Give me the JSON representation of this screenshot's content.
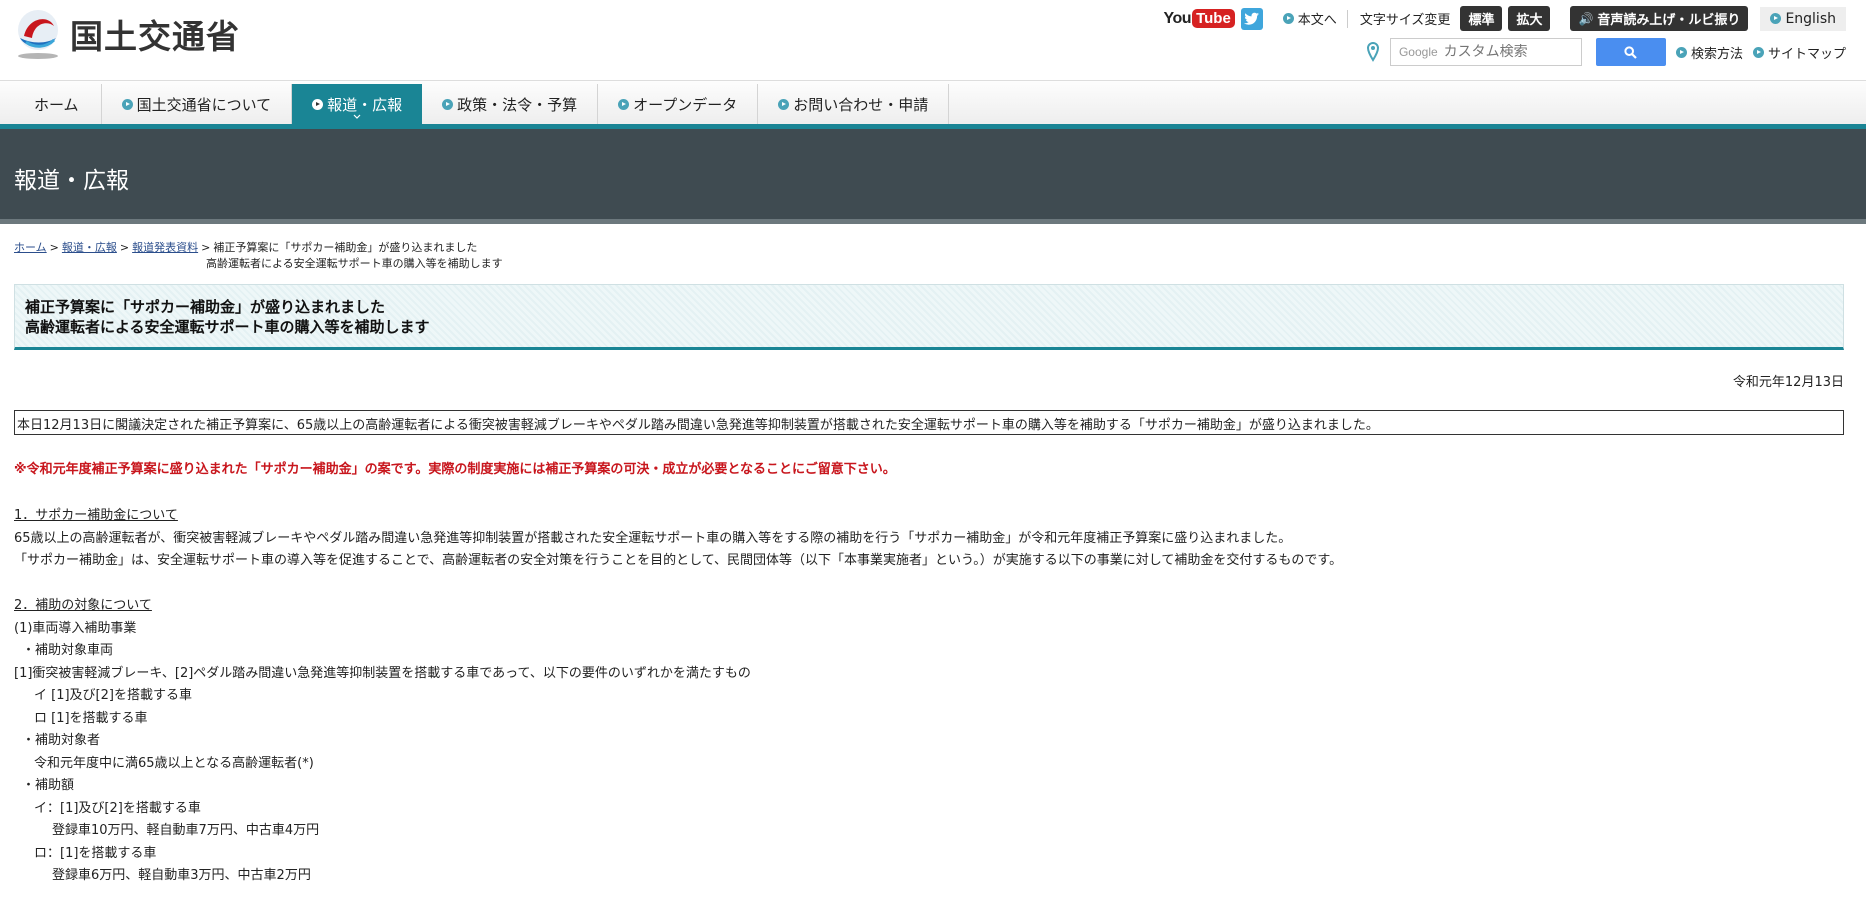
{
  "header": {
    "logo_text": "国土交通省",
    "youtube_you": "You",
    "youtube_tube": "Tube",
    "link_main": "本文へ",
    "text_size_label": "文字サイズ変更",
    "size_standard": "標準",
    "size_large": "拡大",
    "voice_label": "音声読み上げ・ルビ振り",
    "english_label": "English",
    "search_google": "Google",
    "search_placeholder": "カスタム検索",
    "link_search_method": "検索方法",
    "link_sitemap": "サイトマップ"
  },
  "nav": {
    "items": [
      {
        "label": "ホーム"
      },
      {
        "label": "国土交通省について"
      },
      {
        "label": "報道・広報"
      },
      {
        "label": "政策・法令・予算"
      },
      {
        "label": "オープンデータ"
      },
      {
        "label": "お問い合わせ・申請"
      }
    ]
  },
  "page": {
    "title": "報道・広報"
  },
  "breadcrumb": {
    "home": "ホーム",
    "press": "報道・広報",
    "releases": "報道発表資料",
    "current_line1": "補正予算案に「サポカー補助金」が盛り込まれました",
    "current_line2": "高齢運転者による安全運転サポート車の購入等を補助します"
  },
  "article": {
    "title_line1": "補正予算案に「サポカー補助金」が盛り込まれました",
    "title_line2": "高齢運転者による安全運転サポート車の購入等を補助します",
    "date": "令和元年12月13日",
    "summary": "本日12月13日に閣議決定された補正予算案に、65歳以上の高齢運転者による衝突被害軽減ブレーキやペダル踏み間違い急発進等抑制装置が搭載された安全運転サポート車の購入等を補助する「サポカー補助金」が盛り込まれました。",
    "note": "※令和元年度補正予算案に盛り込まれた「サポカー補助金」の案です。実際の制度実施には補正予算案の可決・成立が必要となることにご留意下さい。",
    "section1_heading": "1．サポカー補助金について",
    "section1_p1": "65歳以上の高齢運転者が、衝突被害軽減ブレーキやペダル踏み間違い急発進等抑制装置が搭載された安全運転サポート車の購入等をする際の補助を行う「サポカー補助金」が令和元年度補正予算案に盛り込まれました。",
    "section1_p2": "「サポカー補助金」は、安全運転サポート車の導入等を促進することで、高齢運転者の安全対策を行うことを目的として、民間団体等（以下「本事業実施者」という。）が実施する以下の事業に対して補助金を交付するものです。",
    "section2_heading": "2．補助の対象について",
    "s2_l1": "(1)車両導入補助事業",
    "s2_l2": "・補助対象車両",
    "s2_l3": "[1]衝突被害軽減ブレーキ、[2]ペダル踏み間違い急発進等抑制装置を搭載する車であって、以下の要件のいずれかを満たすもの",
    "s2_l4": "イ [1]及び[2]を搭載する車",
    "s2_l5": "ロ [1]を搭載する車",
    "s2_l6": "・補助対象者",
    "s2_l7": "令和元年度中に満65歳以上となる高齢運転者(*)",
    "s2_l8": "・補助額",
    "s2_l9": "イ：[1]及び[2]を搭載する車",
    "s2_l10": "登録車10万円、軽自動車7万円、中古車4万円",
    "s2_l11": "ロ：[1]を搭載する車",
    "s2_l12": "登録車6万円、軽自動車3万円、中古車2万円"
  },
  "colors": {
    "accent": "#1a8595",
    "title_band": "#3f4b51",
    "note_red": "#c8161d",
    "search_button": "#4a8ef0"
  }
}
